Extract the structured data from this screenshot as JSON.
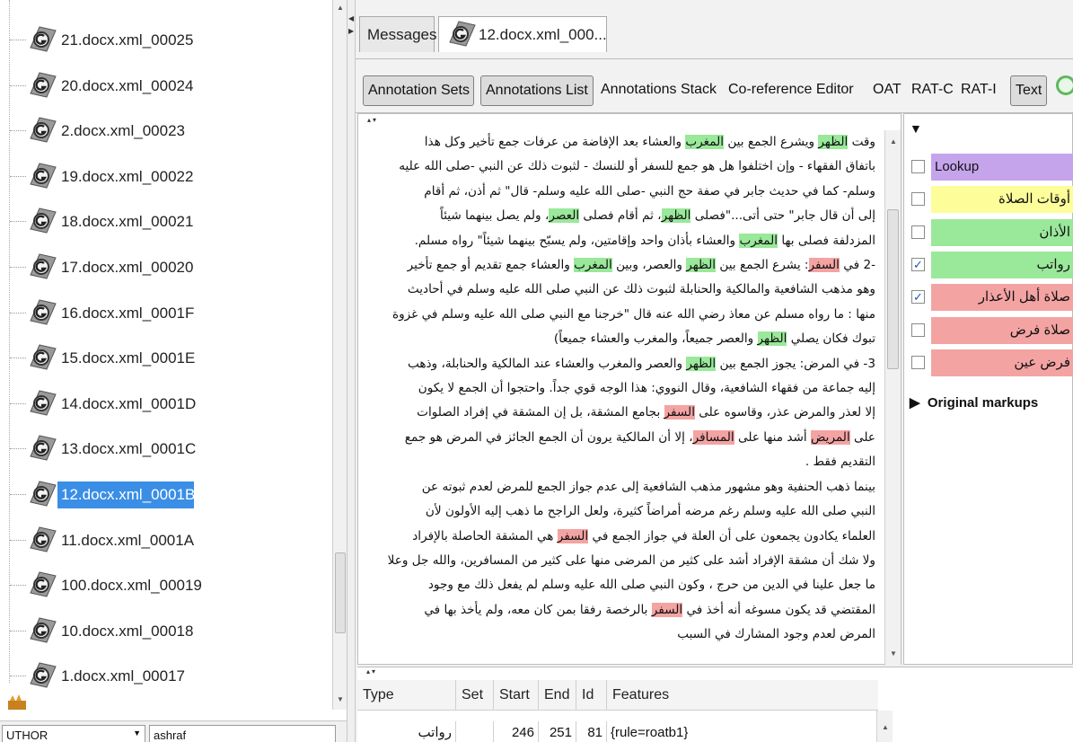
{
  "tree": {
    "items": [
      {
        "label": "21.docx.xml_00025",
        "selected": false
      },
      {
        "label": "20.docx.xml_00024",
        "selected": false
      },
      {
        "label": "2.docx.xml_00023",
        "selected": false
      },
      {
        "label": "19.docx.xml_00022",
        "selected": false
      },
      {
        "label": "18.docx.xml_00021",
        "selected": false
      },
      {
        "label": "17.docx.xml_00020",
        "selected": false
      },
      {
        "label": "16.docx.xml_0001F",
        "selected": false
      },
      {
        "label": "15.docx.xml_0001E",
        "selected": false
      },
      {
        "label": "14.docx.xml_0001D",
        "selected": false
      },
      {
        "label": "13.docx.xml_0001C",
        "selected": false
      },
      {
        "label": "12.docx.xml_0001B",
        "selected": true
      },
      {
        "label": "11.docx.xml_0001A",
        "selected": false
      },
      {
        "label": "100.docx.xml_00019",
        "selected": false
      },
      {
        "label": "10.docx.xml_00018",
        "selected": false
      },
      {
        "label": "1.docx.xml_00017",
        "selected": false
      }
    ],
    "feature_name": "UTHOR",
    "feature_value": "ashraf"
  },
  "tabs": {
    "messages": "Messages",
    "document": "12.docx.xml_000..."
  },
  "toolbar": {
    "annotation_sets": "Annotation Sets",
    "annotations_list": "Annotations List",
    "annotations_stack": "Annotations Stack",
    "coref_editor": "Co-reference Editor",
    "oat": "OAT",
    "rat_c": "RAT-C",
    "rat_i": "RAT-I",
    "text": "Text"
  },
  "annotation_sets": [
    {
      "label": "Lookup",
      "checked": false,
      "color": "#c6a4ec"
    },
    {
      "label": "أوقات الصلاة",
      "checked": false,
      "color": "#fdfd9a"
    },
    {
      "label": "الأذان",
      "checked": false,
      "color": "#9ae89a"
    },
    {
      "label": "رواتب",
      "checked": true,
      "color": "#9ae89a"
    },
    {
      "label": "صلاة أهل الأعذار",
      "checked": true,
      "color": "#f4a3a3"
    },
    {
      "label": "صلاة فرض",
      "checked": false,
      "color": "#f4a3a3"
    },
    {
      "label": "فرض عين",
      "checked": false,
      "color": "#f4a3a3"
    }
  ],
  "original_markups": "Original markups",
  "text_lines": [
    [
      {
        "t": "وقت "
      },
      {
        "t": "الظهر",
        "h": "g"
      },
      {
        "t": " ويشرع الجمع بين "
      },
      {
        "t": "المغرب",
        "h": "g"
      },
      {
        "t": " والعشاء بعد الإفاضة من عرفات جمع تأخير وكل هذا"
      }
    ],
    [
      {
        "t": "باتفاق الفقهاء - وإن اختلفوا هل هو جمع للسفر أو للنسك - لثبوت ذلك عن النبي -صلى الله عليه"
      }
    ],
    [
      {
        "t": "وسلم- كما في حديث جابر في صفة حج النبي -صلى الله عليه وسلم- قال\" ثم أذن، ثم أقام"
      }
    ],
    [
      {
        "t": "إلى أن قال جابر\" حتى أتى...\"فصلى "
      },
      {
        "t": "الظهر",
        "h": "g"
      },
      {
        "t": "، ثم أقام فصلى "
      },
      {
        "t": "العصر",
        "h": "g"
      },
      {
        "t": "، ولم يصل بينهما شيئاً"
      }
    ],
    [
      {
        "t": "المزدلفة فصلى بها "
      },
      {
        "t": "المغرب",
        "h": "g"
      },
      {
        "t": " والعشاء بأذان واحد وإقامتين، ولم يسبّح بينهما شيئاً\" رواه مسلم."
      }
    ],
    [
      {
        "t": "-2 في "
      },
      {
        "t": "السفر",
        "h": "r"
      },
      {
        "t": ": يشرع الجمع بين "
      },
      {
        "t": "الظهر",
        "h": "g"
      },
      {
        "t": " والعصر، وبين "
      },
      {
        "t": "المغرب",
        "h": "g"
      },
      {
        "t": " والعشاء جمع تقديم أو جمع تأخير"
      }
    ],
    [
      {
        "t": "وهو مذهب الشافعية والمالكية والحنابلة لثبوت ذلك عن النبي صلى الله عليه وسلم في أحاديث"
      }
    ],
    [
      {
        "t": "منها : ما رواه مسلم عن معاذ رضي الله عنه قال \"خرجنا مع النبي صلى الله عليه وسلم في غزوة"
      }
    ],
    [
      {
        "t": "تبوك فكان يصلي "
      },
      {
        "t": "الظهر",
        "h": "g"
      },
      {
        "t": " والعصر جميعاً، والمغرب والعشاء جميعاً)"
      }
    ],
    [
      {
        "t": "3- في المرض: يجوز الجمع بين "
      },
      {
        "t": "الظهر",
        "h": "g"
      },
      {
        "t": " والعصر والمغرب والعشاء عند المالكية والحنابلة، وذهب"
      }
    ],
    [
      {
        "t": "إليه جماعة من فقهاء الشافعية، وقال النووي: هذا الوجه قوي جداً. واحتجوا أن الجمع لا يكون"
      }
    ],
    [
      {
        "t": "إلا لعذر والمرض عذر، وقاسوه على "
      },
      {
        "t": "السفر",
        "h": "r"
      },
      {
        "t": " بجامع المشقة، بل إن المشقة في إفراد الصلوات"
      }
    ],
    [
      {
        "t": "على "
      },
      {
        "t": "المريض",
        "h": "r"
      },
      {
        "t": " أشد منها على "
      },
      {
        "t": "المسافر",
        "h": "r"
      },
      {
        "t": "، إلا أن المالكية يرون أن الجمع الجائز في المرض هو جمع"
      }
    ],
    [
      {
        "t": "التقديم فقط ."
      }
    ],
    [
      {
        "t": "بينما ذهب الحنفية وهو مشهور مذهب الشافعية إلى عدم جواز الجمع للمرض لعدم ثبوته عن"
      }
    ],
    [
      {
        "t": "النبي صلى الله عليه وسلم رغم مرضه أمراضاً كثيرة، ولعل الراجح ما ذهب إليه الأولون لأن"
      }
    ],
    [
      {
        "t": "العلماء يكادون يجمعون على أن العلة في جواز الجمع في "
      },
      {
        "t": "السفر",
        "h": "r"
      },
      {
        "t": " هي المشقة الحاصلة بالإفراد"
      }
    ],
    [
      {
        "t": "ولا شك أن مشقة الإفراد أشد على كثير من المرضى منها على كثير من المسافرين، والله جل وعلا"
      }
    ],
    [
      {
        "t": "ما جعل علينا في الدين من حرج ، وكون النبي صلى الله عليه وسلم لم يفعل ذلك مع وجود"
      }
    ],
    [
      {
        "t": "المقتضي قد يكون مسوغه أنه أخذ في "
      },
      {
        "t": "السفر",
        "h": "r"
      },
      {
        "t": " بالرخصة رفقا بمن كان معه، ولم يأخذ بها في"
      }
    ],
    [
      {
        "t": "المرض لعدم وجود المشارك في السبب"
      }
    ]
  ],
  "ann_table": {
    "headers": [
      "Type",
      "Set",
      "Start",
      "End",
      "Id",
      "Features"
    ],
    "row": {
      "type": "رواتب",
      "set": "",
      "start": "246",
      "end": "251",
      "id": "81",
      "features": "{rule=roatb1}"
    }
  }
}
